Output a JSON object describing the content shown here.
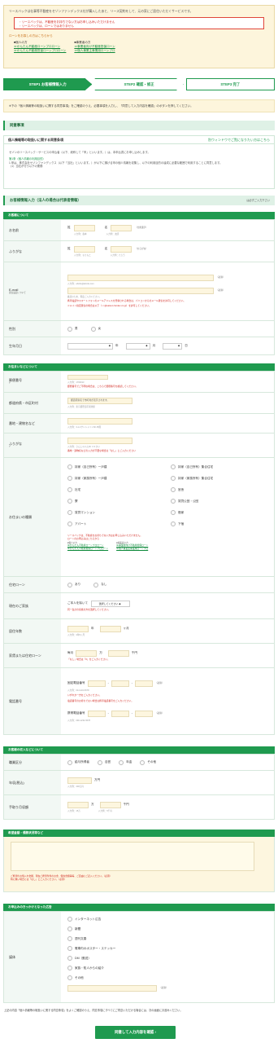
{
  "notice": {
    "intro": "リースバックは仕事等不動産をセゾンファンデックス社が購入したあと、リース契約をして、元の家にご居住いただくサービスです。",
    "warn1": "・リースバックは、不動産をお持ちでない方はお申し込みいただけません",
    "warn2": "・リースバックは、ローンではありません",
    "heading": "ローンをお探しの方はこちらから",
    "left_label": "■個人の方",
    "left_links": [
      "≫かんたん不動産ローンプロローン",
      "≫かんたん不動産担保ローンプロローン"
    ],
    "right_label": "■事業者の方",
    "right_links": [
      "≫事業者向け不動産担保ローン",
      "≫個人事業主事業用ローンプロ"
    ]
  },
  "steps": [
    {
      "label": "STEP1 お客様情報入力",
      "active": true
    },
    {
      "label": "STEP2 確認・修正",
      "active": false
    },
    {
      "label": "STEP3 完了",
      "active": false
    }
  ],
  "guide": "※下の「個人情報等の取扱いに関する同意事項」をご確認のうえ、必要事項を入力し、「同意して入力内容を確認」のボタンを押してください。",
  "caution": "同意事項",
  "privacy": {
    "title": "個人情報等の取扱いに関する同意条項",
    "link": "別ウィンドウでご覧になりたい方はこちら",
    "p1": "セゾンのリースバック・サービスの申込者（以下、総称して「甲」といいます。）は、本申込書にお申し込みします。",
    "sub": "第1条（個人情報の利用目的）",
    "p2": "1.甲は、株式会社セゾンファンデックス（以下「当社」といいます。）が以下に揚げる甲の個人情報を収集し、以下の利用目的の達成に必要な範囲で利用することに同意します。",
    "p3": "（1）当社が行う以下の業務"
  },
  "customer": {
    "title": "お客様情報入力（法人の場合は代表者情報）",
    "required_note": "は必ずご入力下さい"
  },
  "sec_about": "お客様について",
  "sec_home": "お住まいなどについて",
  "sec_income": "お客様の収入などについて",
  "sec_remarks": "希望金額・債務状況等など",
  "sec_trigger": "お申込みのきっかけとなった広告",
  "name": {
    "label": "お名前",
    "sei": "姓",
    "mei": "名",
    "h_sei": "入力例：森本",
    "h_mei": "入力例：太郎",
    "tag": "（全角漢字）"
  },
  "kana": {
    "label": "ふりがな",
    "sei": "姓",
    "mei": "名",
    "h_sei": "入力例：もりもと",
    "h_mei": "入力例：たろう",
    "tag": "（ひらがな）"
  },
  "email": {
    "label": "E-mail",
    "sub": "受信設定について",
    "hint1": "入力例：abcde@abcde.com",
    "hint2": "確認のため、再度ご入力ください。",
    "red1": "携帯電話やスマートフォンのメールアドレスを登録される場合は、パソコンからのメール受信を許可してください。",
    "red2": "ドメイン指定受信の場合は以下（○○@saison-fundex.co.jp）を許可してください。",
    "tag": "（必須）"
  },
  "gender": {
    "label": "性別",
    "opts": [
      "男",
      "女"
    ]
  },
  "birth": {
    "label": "生年月日",
    "y": "年",
    "m": "月",
    "d": "日"
  },
  "zip": {
    "label": "郵便番号",
    "hint": "入力例：1700013",
    "red": "郵便番号でご不明な場合は、こちらで郵便番号を確認してください。"
  },
  "pref": {
    "label": "都道府県・市区町村",
    "placeholder": "都道府県名で市町村が表示されます。",
    "hint": "入力例：東京都豊島区東池袋"
  },
  "addr": {
    "label": "番地・建物名など",
    "hint": "入力例：3-1-1サンシャイン60 45階"
  },
  "addrkana": {
    "label": "ふりがな",
    "hint": "入力例：さんしゃいん60 ４５かい",
    "red": "番地・建物名などの入力が不要な場合は「なし」とご入力ください"
  },
  "residence": {
    "label": "お住まいの種類",
    "opts": [
      "持家（自己所有）一戸建",
      "持家（自己所有）集合住宅",
      "持家（家族所有）一戸建",
      "持家（家族所有）集合住宅",
      "社宅",
      "官舎",
      "寮",
      "賃貸公団・公団",
      "賃貸マンション",
      "借家",
      "アパート",
      "下宿"
    ],
    "note": "リースバックは、不動産をお持ちでない方はお申し込みいただけません。",
    "note2": "ローンのお申込みはこちらから",
    "ll": "■個人の方",
    "lr": "■事業者の方",
    "links_l": [
      "≫かんたん不動産ローンプロローン",
      "≫かんたん不動産担保ローンプロローン"
    ],
    "links_r": [
      "≫事業者向け不動産担保ローン",
      "≫個人事業主事業用ローンプロ"
    ]
  },
  "loan": {
    "label": "住宅ローン",
    "opts": [
      "あり",
      "なし"
    ]
  },
  "living": {
    "label": "現在のご家族",
    "prefix": "ご本人を除いて",
    "select": "選択してください",
    "red": "同一生計の家族の方を選択してください。"
  },
  "years": {
    "label": "居住年数",
    "unit_y": "年",
    "unit_m": "ヶ月",
    "hint": "入力例：3年5ヶ月"
  },
  "monthly": {
    "label": "家賃または住宅ローン",
    "pre": "毎月",
    "man": "万",
    "sen": "千円",
    "red": "「なし」場合は「0」をご入力ください。"
  },
  "phone": {
    "label": "電話番号",
    "fixed": "固定電話番号",
    "mobile": "携帯電話番号",
    "h1": "入力例：03-1234-5678",
    "h2": "入力例：090-1234-5678",
    "red1": "いずれか一方をご入力ください。",
    "red2": "電話番号のお持ちでない場合は携帯電話番号をご入力ください。",
    "tag": "（必須）"
  },
  "job": {
    "label": "職業区分",
    "opts": [
      "給与所得者",
      "自営",
      "年金",
      "その他"
    ]
  },
  "income": {
    "label": "年収(税込)",
    "unit": "万円",
    "hint": "入力例：300万円"
  },
  "takehome": {
    "label": "手取り月収額",
    "man": "万",
    "sen": "千円",
    "h1": "入力例：15万",
    "h2": "入力例：5千円"
  },
  "remarks": {
    "red1": "ご希望のお借入れ金額、現在ご希望条件のお金、借換金額等等、ご自由にご記入ください。（必須）",
    "red2": "特に無い場合には「なし」とご入力ください。（必須）"
  },
  "trigger": {
    "label": "媒体",
    "opts": [
      "インターネット広告",
      "新聞",
      "週刊文春",
      "電車内のポスター・ステッカー",
      "DM（郵送）",
      "家族・知人からの紹介",
      "その他"
    ],
    "tag": "（必須）"
  },
  "footnote": "上記の内容「個人情報等の取扱いに関する同意条項」をよくご確認のうえ、同意事項にすべてにご同意いただける場合には、次の画面にお進みください。",
  "confirm": "同意して入力内容を確認"
}
